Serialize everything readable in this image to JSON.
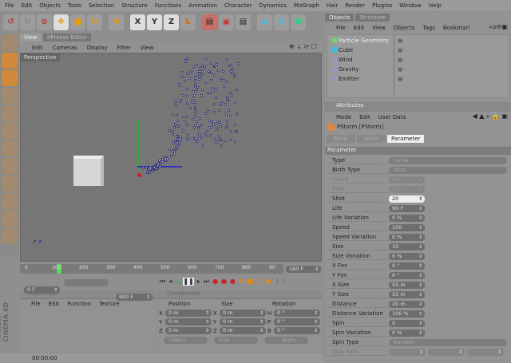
{
  "menu": [
    "File",
    "Edit",
    "Objects",
    "Tools",
    "Selection",
    "Structure",
    "Functions",
    "Animation",
    "Character",
    "Dynamics",
    "MoGraph",
    "Hair",
    "Render",
    "Plugins",
    "Window",
    "Help"
  ],
  "toolbar": {
    "icons": [
      "undo-icon",
      "redo-icon",
      "select-icon",
      "move-icon",
      "scale-icon",
      "rotate-icon",
      "add-icon"
    ],
    "axes": [
      "X",
      "Y",
      "Z"
    ]
  },
  "view_tabs": [
    "View",
    "XPresso Editor"
  ],
  "view_menu": [
    "Edit",
    "Cameras",
    "Display",
    "Filter",
    "View"
  ],
  "viewport_label": "Perspective",
  "objects_tabs": [
    "Objects",
    "Structure"
  ],
  "objects_menu": [
    "File",
    "Edit",
    "View",
    "Objects",
    "Tags",
    "Bookmarl"
  ],
  "objects": [
    "Particle Geometry",
    "Cube",
    "Wind",
    "Gravity",
    "Emitter"
  ],
  "attributes": {
    "title": "Attributes",
    "menu": [
      "Mode",
      "Edit",
      "User Data"
    ],
    "object": "PStorm [PStorm]",
    "tabs": [
      "Basic",
      "Node",
      "Parameter"
    ],
    "section": "Parameter"
  },
  "params": [
    {
      "label": "Type",
      "value": "Circle",
      "kind": "drop"
    },
    {
      "label": "Birth Type",
      "value": "Shot",
      "kind": "drop"
    },
    {
      "label": "Count",
      "value": "10",
      "kind": "dis"
    },
    {
      "label": "Rate",
      "value": "250",
      "kind": "dis"
    },
    {
      "label": "Shot",
      "value": "20",
      "kind": "edit"
    },
    {
      "label": "Life",
      "value": "90 F"
    },
    {
      "label": "Life Variation",
      "value": "0 %"
    },
    {
      "label": "Speed",
      "value": "100"
    },
    {
      "label": "Speed Variation",
      "value": "0 %"
    },
    {
      "label": "Size",
      "value": "10"
    },
    {
      "label": "Size Variation",
      "value": "0 %"
    },
    {
      "label": "X Fov",
      "value": "0 °"
    },
    {
      "label": "Y Fov",
      "value": "0 °"
    },
    {
      "label": "X Size",
      "value": "55 m"
    },
    {
      "label": "Y Size",
      "value": "55 m"
    },
    {
      "label": "Distance",
      "value": "20 m"
    },
    {
      "label": "Distance Variation",
      "value": "100 %"
    },
    {
      "label": "Spin",
      "value": "0"
    },
    {
      "label": "Spin Variation",
      "value": "0 %"
    },
    {
      "label": "Spin Type",
      "value": "Random",
      "kind": "drop"
    },
    {
      "label": "Spin Axis",
      "value": "",
      "kind": "axis"
    }
  ],
  "timeline": {
    "ticks": [
      "0",
      "100",
      "200",
      "300",
      "400",
      "500",
      "600",
      "700",
      "800",
      "90"
    ],
    "end_frame": "160 F",
    "start": "0 F",
    "max": "900 F",
    "current_fraction": 0.13
  },
  "materials": {
    "title": "Materials",
    "menu": [
      "File",
      "Edit",
      "Function",
      "Texture"
    ]
  },
  "coordinates": {
    "title": "Coordinates",
    "headers": [
      "Position",
      "Size",
      "Rotation"
    ],
    "rows": [
      [
        "X",
        "0 m",
        "X",
        "0 m",
        "H",
        "0 °"
      ],
      [
        "Y",
        "0 m",
        "Y",
        "0 m",
        "P",
        "0 °"
      ],
      [
        "Z",
        "0 m",
        "Z",
        "0 m",
        "B",
        "0 °"
      ]
    ],
    "mode1": "Object",
    "mode2": "Size",
    "apply": "Apply"
  },
  "status_time": "00:00:00",
  "brand": "MAXON CINEMA 4D"
}
